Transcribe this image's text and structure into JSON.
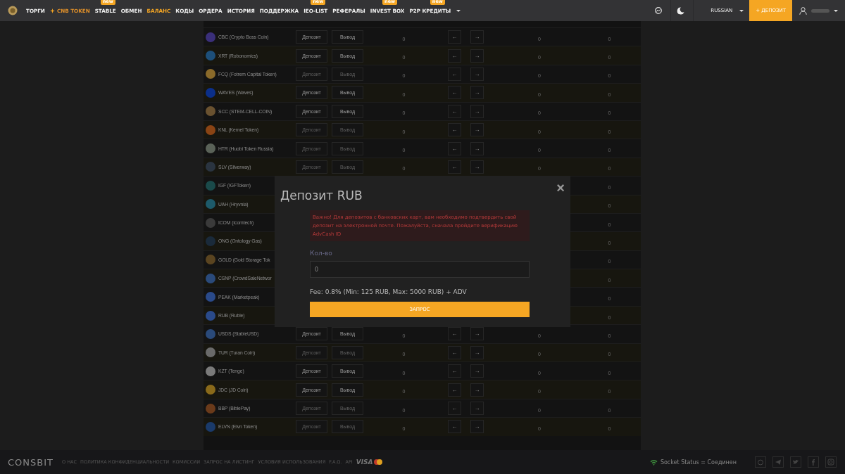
{
  "header": {
    "nav": [
      {
        "label": "ТОРГИ",
        "kind": "plain",
        "selected": false
      },
      {
        "label": "CNB TOKEN",
        "kind": "highlight",
        "selected": false
      },
      {
        "label": "STABLE",
        "kind": "plain",
        "selected": false,
        "badge": "new"
      },
      {
        "label": "ОБМЕН",
        "kind": "plain",
        "selected": false
      },
      {
        "label": "БАЛАНС",
        "kind": "plain",
        "selected": true
      },
      {
        "label": "КОДЫ",
        "kind": "plain",
        "selected": false
      },
      {
        "label": "ОРДЕРА",
        "kind": "plain",
        "selected": false
      },
      {
        "label": "ИСТОРИЯ",
        "kind": "plain",
        "selected": false
      },
      {
        "label": "ПОДДЕРЖКА",
        "kind": "plain",
        "selected": false
      },
      {
        "label": "IEO-LIST",
        "kind": "plain",
        "selected": false,
        "badge": "new"
      },
      {
        "label": "РЕФЕРАЛЫ",
        "kind": "plain",
        "selected": false
      },
      {
        "label": "INVEST BOX",
        "kind": "plain",
        "selected": false,
        "badge": "new"
      },
      {
        "label": "P2P КРЕДИТЫ",
        "kind": "dropdown",
        "selected": false,
        "badge": "new"
      }
    ],
    "language": "RUSSIAN",
    "deposit_button": "+ ДЕПОЗИТ"
  },
  "table": {
    "rows": [
      {
        "name": "CBC (Crypto Boss Coin)",
        "color": "#3a2f7a",
        "deposit": "Депозит",
        "withdraw": "Вывод",
        "disabled": false,
        "value": "0",
        "left": "←",
        "right": "→",
        "column_6": "0",
        "column_7": "0"
      },
      {
        "name": "XRT (Robonomics)",
        "color": "#1d4f7a",
        "deposit": "Депозит",
        "withdraw": "Вывод",
        "disabled": false,
        "value": "0",
        "left": "←",
        "right": "→",
        "column_6": "0",
        "column_7": "0"
      },
      {
        "name": "FCQ (Fotrem Capital Token)",
        "color": "#8a6a2a",
        "deposit": "Депозит",
        "withdraw": "Вывод",
        "disabled": true,
        "value": "0",
        "left": "←",
        "right": "→",
        "column_6": "0",
        "column_7": "0"
      },
      {
        "name": "WAVES (Waves)",
        "color": "#0b2f8a",
        "deposit": "Депозит",
        "withdraw": "Вывод",
        "disabled": false,
        "value": "0",
        "left": "←",
        "right": "→",
        "column_6": "0",
        "column_7": "0"
      },
      {
        "name": "SCC (STEM-CELL-COIN)",
        "color": "#6a5230",
        "deposit": "Депозит",
        "withdraw": "Вывод",
        "disabled": false,
        "value": "0",
        "left": "←",
        "right": "→",
        "column_6": "0",
        "column_7": "0"
      },
      {
        "name": "KNL (Kernel Token)",
        "color": "#8a4414",
        "deposit": "Депозит",
        "withdraw": "Вывод",
        "disabled": true,
        "value": "0",
        "left": "←",
        "right": "→",
        "column_6": "0",
        "column_7": "0"
      },
      {
        "name": "HTR (Huobi Token Russia)",
        "color": "#5a6258",
        "deposit": "Депозит",
        "withdraw": "Вывод",
        "disabled": true,
        "value": "0",
        "left": "←",
        "right": "→",
        "column_6": "0",
        "column_7": "0"
      },
      {
        "name": "SLV (Silverway)",
        "color": "#2a3440",
        "deposit": "Депозит",
        "withdraw": "Вывод",
        "disabled": true,
        "value": "0",
        "left": "←",
        "right": "→",
        "column_6": "0",
        "column_7": "0"
      },
      {
        "name": "IGF (IGFToken)",
        "color": "#1a4a4a",
        "column_7": "0"
      },
      {
        "name": "UAH (Hryvnia)",
        "color": "#1d5a6a",
        "column_7": "0"
      },
      {
        "name": "ICOM (Icomtech)",
        "color": "#3a3a3a",
        "column_7": "0"
      },
      {
        "name": "ONG (Ontology Gas)",
        "color": "#1a2a3a",
        "column_7": "0"
      },
      {
        "name": "GOLD (Gold Storage Tok",
        "color": "#5a4420",
        "column_7": "0"
      },
      {
        "name": "CSNP (CrowdSaleNetwor",
        "color": "#2a4a7a",
        "column_7": "0"
      },
      {
        "name": "PEAK (Marketpeak)",
        "color": "#2a4a8a",
        "column_7": "0"
      },
      {
        "name": "RUB (Ruble)",
        "color": "#2a4a8a",
        "column_7": "0"
      },
      {
        "name": "USDS (StableUSD)",
        "color": "#2a4a7a",
        "deposit": "Депозит",
        "withdraw": "Вывод",
        "disabled": false,
        "value": "0",
        "left": "←",
        "right": "→",
        "column_6": "0",
        "column_7": "0"
      },
      {
        "name": "TUR (Turan Coin)",
        "color": "#6a6a6a",
        "deposit": "Депозит",
        "withdraw": "Вывод",
        "disabled": true,
        "value": "0",
        "left": "←",
        "right": "→",
        "column_6": "0",
        "column_7": "0"
      },
      {
        "name": "KZT (Tenge)",
        "color": "#7a7a7a",
        "deposit": "Депозит",
        "withdraw": "Вывод",
        "disabled": false,
        "value": "0",
        "left": "←",
        "right": "→",
        "column_6": "0",
        "column_7": "0"
      },
      {
        "name": "JDC (JD Coin)",
        "color": "#8a6a1a",
        "deposit": "Депозит",
        "withdraw": "Вывод",
        "disabled": false,
        "value": "0",
        "left": "←",
        "right": "→",
        "column_6": "0",
        "column_7": "0"
      },
      {
        "name": "BBP (BiblePay)",
        "color": "#6a3a1a",
        "deposit": "Депозит",
        "withdraw": "Вывод",
        "disabled": true,
        "value": "0",
        "left": "←",
        "right": "→",
        "column_6": "0",
        "column_7": "0"
      },
      {
        "name": "ELVN (Elvn Token)",
        "color": "#1a3a6a",
        "deposit": "Депозит",
        "withdraw": "Вывод",
        "disabled": true,
        "value": "0",
        "left": "←",
        "right": "→",
        "column_6": "0",
        "column_7": "0"
      }
    ]
  },
  "modal": {
    "title": "Депозит RUB",
    "close": "×",
    "warning": "Важно! Для депозитов с банковских карт, вам необходимо подтвердить свой депозит на электронной почте. Пожалуйста, сначала пройдите верификацию AdvCash ID",
    "amount_label": "Кол-во",
    "amount_value": "0",
    "fee": "Fee: 0.8% (Min: 125 RUB, Max: 5000 RUB) + ADV",
    "submit": "ЗАПРОС"
  },
  "footer": {
    "logo": "CONSBIT",
    "links": [
      "О НАС",
      "ПОЛИТИКА КОНФИДЕНЦИАЛЬНОСТИ",
      "КОМИССИИ",
      "ЗАПРОС НА ЛИСТИНГ",
      "УСЛОВИЯ ИСПОЛЬЗОВАНИЯ",
      "F.A.Q.",
      "API"
    ],
    "card_logo": "VISA",
    "socket_status": "Socket Status = Соединен"
  }
}
